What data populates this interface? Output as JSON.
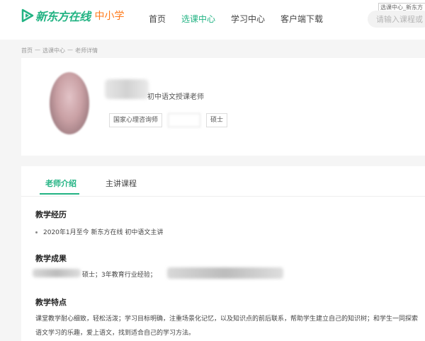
{
  "header": {
    "brand": "新东方在线",
    "brand_sub": "中小学",
    "nav": [
      "首页",
      "选课中心",
      "学习中心",
      "客户端下载"
    ],
    "active_nav": "选课中心",
    "search_hint": "选课中心_新东方",
    "search_placeholder": "请输入课程或"
  },
  "breadcrumb": [
    "首页",
    "—",
    "选课中心",
    "—",
    "老师详情"
  ],
  "teacher": {
    "title": "初中语文授课老师",
    "tags": [
      "国家心理咨询师",
      "",
      "硕士"
    ]
  },
  "tabs": [
    "老师介绍",
    "主讲课程"
  ],
  "sections": {
    "experience": {
      "title": "教学经历",
      "items": [
        "2020年1月至今 新东方在线 初中语文主讲"
      ]
    },
    "achievements": {
      "title": "教学成果",
      "text": "硕士；3年教育行业经验；"
    },
    "features": {
      "title": "教学特点",
      "text": "课堂教学耐心细致，轻松活泼；学习目标明确，注重场景化记忆，以及知识点的前后联系，帮助学生建立自己的知识树；和学生一同探索语文学习的乐趣，爱上语文，找到适合自己的学习方法。"
    }
  },
  "colors": {
    "accent": "#22b383",
    "brand_orange": "#ff7a1a"
  }
}
